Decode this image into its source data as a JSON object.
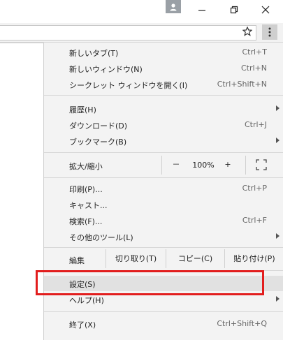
{
  "menu": {
    "new_tab": {
      "label": "新しいタブ(T)",
      "shortcut": "Ctrl+T"
    },
    "new_window": {
      "label": "新しいウィンドウ(N)",
      "shortcut": "Ctrl+N"
    },
    "incognito": {
      "label": "シークレット ウィンドウを開く(I)",
      "shortcut": "Ctrl+Shift+N"
    },
    "history": {
      "label": "履歴(H)"
    },
    "downloads": {
      "label": "ダウンロード(D)",
      "shortcut": "Ctrl+J"
    },
    "bookmarks": {
      "label": "ブックマーク(B)"
    },
    "zoom": {
      "label": "拡大/縮小",
      "minus": "－",
      "value": "100%",
      "plus": "+"
    },
    "print": {
      "label": "印刷(P)...",
      "shortcut": "Ctrl+P"
    },
    "cast": {
      "label": "キャスト..."
    },
    "find": {
      "label": "検索(F)...",
      "shortcut": "Ctrl+F"
    },
    "more_tools": {
      "label": "その他のツール(L)"
    },
    "edit": {
      "label": "編集",
      "cut": "切り取り(T)",
      "copy": "コピー(C)",
      "paste": "貼り付け(P)"
    },
    "settings": {
      "label": "設定(S)"
    },
    "help": {
      "label": "ヘルプ(H)"
    },
    "exit": {
      "label": "終了(X)",
      "shortcut": "Ctrl+Shift+Q"
    }
  },
  "annotation": {
    "color": "#e21d1d"
  },
  "icons": {
    "profile": "person-icon",
    "minimize": "minimize-icon",
    "maximize": "restore-icon",
    "close": "close-icon",
    "star": "star-icon",
    "menu": "kebab-menu-icon",
    "fullscreen": "fullscreen-icon"
  }
}
